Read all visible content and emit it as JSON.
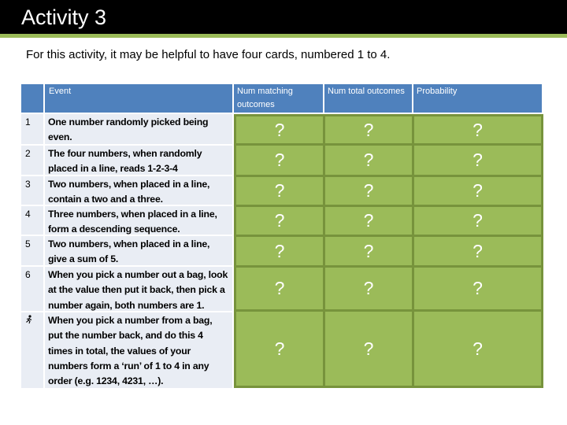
{
  "slide": {
    "title": "Activity 3",
    "subtitle": "For this activity, it may be helpful to have four cards, numbered 1 to 4."
  },
  "table": {
    "headers": {
      "number": "",
      "event": "Event",
      "matching": "Num matching outcomes",
      "total": "Num total outcomes",
      "probability": "Probability"
    },
    "rows": [
      {
        "num": "1",
        "event": "One number randomly picked being even.",
        "matching": "?",
        "total": "?",
        "probability": "?"
      },
      {
        "num": "2",
        "event": "The four numbers, when randomly placed in a line, reads 1-2-3-4",
        "matching": "?",
        "total": "?",
        "probability": "?"
      },
      {
        "num": "3",
        "event": "Two numbers, when placed in a line, contain a two and a three.",
        "matching": "?",
        "total": "?",
        "probability": "?"
      },
      {
        "num": "4",
        "event": "Three numbers, when placed in a line, form a descending sequence.",
        "matching": "?",
        "total": "?",
        "probability": "?"
      },
      {
        "num": "5",
        "event": "Two numbers, when placed in a line, give a sum of 5.",
        "matching": "?",
        "total": "?",
        "probability": "?"
      },
      {
        "num": "6",
        "event": "When you pick a number out a bag, look at the value then put it back, then pick a number again, both numbers are 1.",
        "matching": "?",
        "total": "?",
        "probability": "?"
      },
      {
        "num": "runner-icon",
        "event": "When you pick a number from a bag, put the number back, and do this 4 times in total, the values of your numbers form a ‘run’ of 1 to 4 in any order (e.g. 1234, 4231, …).",
        "matching": "?",
        "total": "?",
        "probability": "?"
      }
    ]
  },
  "colors": {
    "header_blue": "#4f81bd",
    "answer_green": "#9bbb59",
    "answer_border": "#77933c",
    "row_bg": "#e9edf4",
    "title_bg": "#000000"
  }
}
